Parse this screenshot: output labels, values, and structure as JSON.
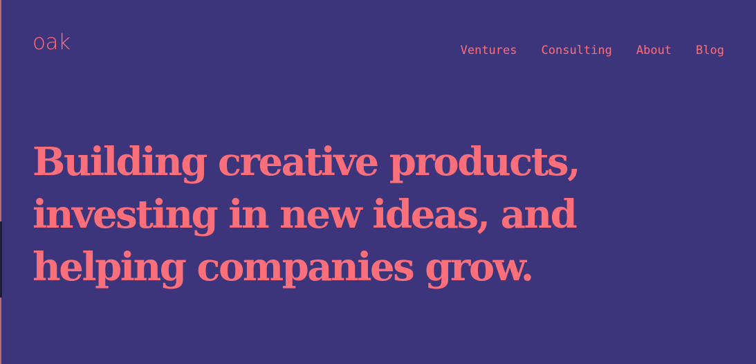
{
  "brand": {
    "logo_text": "oak"
  },
  "nav": {
    "items": [
      {
        "label": "Ventures"
      },
      {
        "label": "Consulting"
      },
      {
        "label": "About"
      },
      {
        "label": "Blog"
      }
    ]
  },
  "hero": {
    "lines": [
      "Building creative products,",
      "investing in new ideas, and",
      "helping companies grow."
    ]
  },
  "colors": {
    "background": "#3c357b",
    "accent": "#fb6f7a"
  }
}
